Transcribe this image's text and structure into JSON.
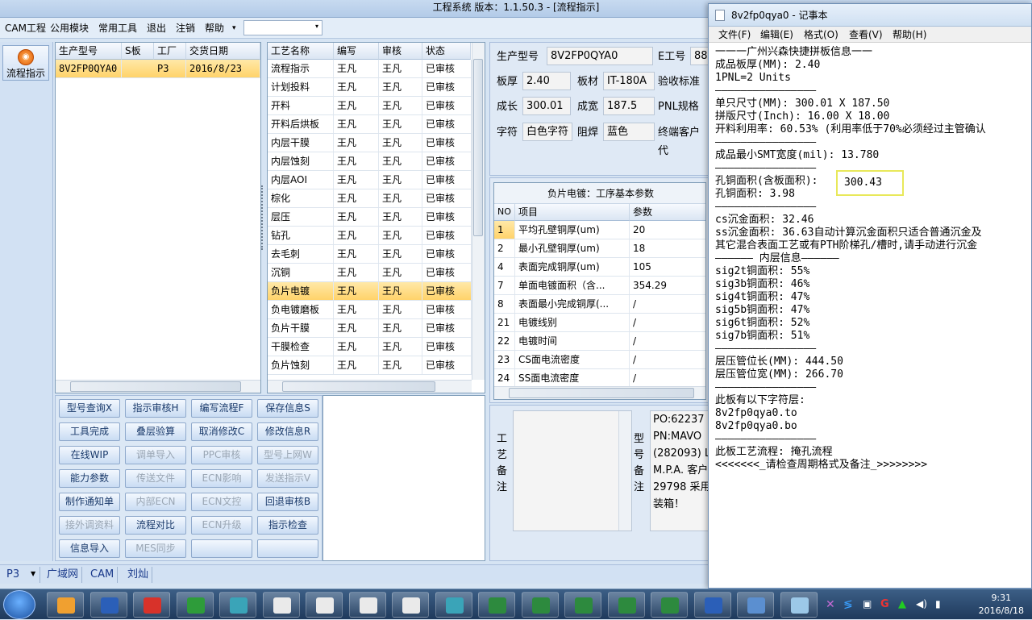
{
  "app": {
    "title": "工程系统   版本：1.1.50.3 - [流程指示]",
    "menu": [
      "CAM工程",
      "公用模块",
      "常用工具",
      "退出",
      "注销",
      "帮助"
    ],
    "help_arrow": "▾",
    "combo_value": "",
    "combo_arrow": "▾"
  },
  "left_strip": {
    "button_label": "流程指示"
  },
  "model_grid": {
    "headers": [
      "生产型号",
      "S板",
      "工厂",
      "交货日期"
    ],
    "rows": [
      [
        "8V2FP0QYA0",
        "",
        "P3",
        "2016/8/23"
      ]
    ]
  },
  "process_grid": {
    "headers": [
      "工艺名称",
      "编写",
      "审核",
      "状态"
    ],
    "rows": [
      [
        "流程指示",
        "王凡",
        "王凡",
        "已审核"
      ],
      [
        "计划投料",
        "王凡",
        "王凡",
        "已审核"
      ],
      [
        "开料",
        "王凡",
        "王凡",
        "已审核"
      ],
      [
        "开料后烘板",
        "王凡",
        "王凡",
        "已审核"
      ],
      [
        "内层干膜",
        "王凡",
        "王凡",
        "已审核"
      ],
      [
        "内层蚀刻",
        "王凡",
        "王凡",
        "已审核"
      ],
      [
        "内层AOI",
        "王凡",
        "王凡",
        "已审核"
      ],
      [
        "棕化",
        "王凡",
        "王凡",
        "已审核"
      ],
      [
        "层压",
        "王凡",
        "王凡",
        "已审核"
      ],
      [
        "钻孔",
        "王凡",
        "王凡",
        "已审核"
      ],
      [
        "去毛刺",
        "王凡",
        "王凡",
        "已审核"
      ],
      [
        "沉铜",
        "王凡",
        "王凡",
        "已审核"
      ],
      [
        "负片电镀",
        "王凡",
        "王凡",
        "已审核"
      ],
      [
        "负电镀磨板",
        "王凡",
        "王凡",
        "已审核"
      ],
      [
        "负片干膜",
        "王凡",
        "王凡",
        "已审核"
      ],
      [
        "干膜检查",
        "王凡",
        "王凡",
        "已审核"
      ],
      [
        "负片蚀刻",
        "王凡",
        "王凡",
        "已审核"
      ]
    ],
    "selected_index": 12
  },
  "buttons": [
    [
      "型号查询X",
      "指示审核H",
      "编写流程F",
      "保存信息S"
    ],
    [
      "工具完成",
      "叠层验算",
      "取消修改C",
      "修改信息R"
    ],
    [
      "在线WIP",
      "调单导入",
      "PPC审核",
      "型号上网W"
    ],
    [
      "能力参数",
      "传送文件",
      "ECN影响",
      "发送指示V"
    ],
    [
      "制作通知单",
      "内部ECN",
      "ECN文控",
      "回退审核B"
    ],
    [
      "接外调资料",
      "流程对比",
      "ECN升级",
      "指示检查"
    ],
    [
      "信息导入",
      "MES同步",
      "",
      ""
    ]
  ],
  "disabled_buttons": [
    "调单导入",
    "PPC审核",
    "型号上网W",
    "传送文件",
    "ECN影响",
    "发送指示V",
    "内部ECN",
    "ECN文控",
    "接外调资料",
    "ECN升级",
    "MES同步"
  ],
  "info": {
    "model_label": "生产型号",
    "model_value": "8V2FP0QYA0",
    "e_label": "E工号",
    "e_value": "88",
    "thick_label": "板厚",
    "thick_value": "2.40",
    "material_label": "板材",
    "material_value": "IT-180A",
    "accept_label": "验收标准",
    "len_label": "成长",
    "len_value": "300.01",
    "width_label": "成宽",
    "width_value": "187.5",
    "pnl_label": "PNL规格",
    "char_label": "字符",
    "char_value": "白色字符",
    "mask_label": "阻焊",
    "mask_value": "蓝色",
    "customer_label": "终端客户代"
  },
  "param_grid": {
    "title": "负片电镀：工序基本参数",
    "headers": [
      "NO",
      "项目",
      "参数"
    ],
    "rows": [
      [
        "1",
        "平均孔壁铜厚(um)",
        "20"
      ],
      [
        "2",
        "最小孔壁铜厚(um)",
        "18"
      ],
      [
        "4",
        "表面完成铜厚(um)",
        "105"
      ],
      [
        "7",
        "单面电镀面积（含...",
        "354.29"
      ],
      [
        "8",
        "表面最小完成铜厚(...",
        "/"
      ],
      [
        "21",
        "电镀线别",
        "/"
      ],
      [
        "22",
        "电镀时间",
        "/"
      ],
      [
        "23",
        "CS面电流密度",
        "/"
      ],
      [
        "24",
        "SS面电流密度",
        "/"
      ]
    ],
    "selected_index": 0
  },
  "remarks": {
    "process_label": [
      "工",
      "艺",
      "备",
      "注"
    ],
    "model_label": [
      "型",
      "号",
      "备",
      "注"
    ],
    "model_text": [
      "PO:62237",
      "PN:MAVO",
      "(282093) L",
      "M.P.A. 客户",
      "29798 采用",
      "装箱！"
    ]
  },
  "status": [
    "P3",
    "广域网",
    "CAM",
    "刘灿"
  ],
  "notepad": {
    "title": "8v2fp0qya0 - 记事本",
    "menu": [
      "文件(F)",
      "编辑(E)",
      "格式(O)",
      "查看(V)",
      "帮助(H)"
    ],
    "lines": [
      "一一一广州兴森快捷拼板信息一一",
      "成品板厚(MM): 2.40",
      "1PNL=2 Units",
      "————————————————",
      "单只尺寸(MM): 300.01 X 187.50",
      "拼版尺寸(Inch): 16.00 X 18.00",
      "开料利用率: 60.53% (利用率低于70%必须经过主管确认",
      "————————————————",
      "成品最小SMT宽度(mil): 13.780",
      "————————————————",
      "孔铜面积(含板面积):",
      "孔铜面积: 3.98",
      "————————————————",
      "cs沉金面积: 32.46",
      "ss沉金面积: 36.63自动计算沉金面积只适合普通沉金及",
      "其它混合表面工艺或有PTH阶梯孔/槽时,请手动进行沉金",
      "—————— 内层信息——————",
      "sig2t铜面积: 55%",
      "sig3b铜面积: 46%",
      "sig4t铜面积: 47%",
      "sig5b铜面积: 47%",
      "sig6t铜面积: 52%",
      "sig7b铜面积: 51%",
      "————————————————",
      "层压管位长(MM): 444.50",
      "层压管位宽(MM): 266.70",
      "————————————————",
      "此板有以下字符层:",
      "8v2fp0qya0.to",
      "8v2fp0qya0.bo",
      "————————————————",
      "此板工艺流程: 掩孔流程",
      "<<<<<<<_请检查周期格式及备注_>>>>>>>>"
    ],
    "highlight_value": "300.43"
  },
  "taskbar": {
    "time": "9:31",
    "date": "2016/8/18"
  }
}
